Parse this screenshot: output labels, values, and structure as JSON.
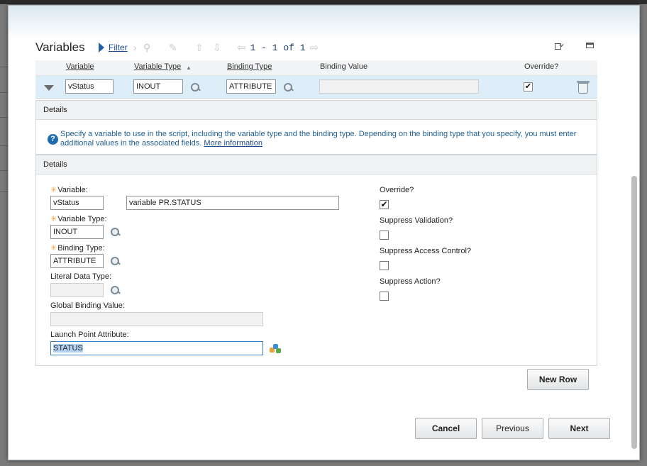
{
  "section": {
    "title": "Variables",
    "filter_label": "Filter",
    "pager_text": "1 - 1 of 1"
  },
  "table": {
    "columns": [
      "Variable",
      "Variable Type",
      "Binding Type",
      "Binding Value",
      "Override?"
    ],
    "rows": [
      {
        "variable": "vStatus",
        "variable_type": "INOUT",
        "binding_type": "ATTRIBUTE",
        "binding_value": "",
        "override": true
      }
    ]
  },
  "details_top": {
    "header": "Details",
    "help_text": "Specify a variable to use in the script, including the variable type and the binding type. Depending on the binding type that you specify, you must enter additional values in the associated fields.",
    "help_link": "More information"
  },
  "details_form": {
    "header": "Details",
    "variable_label": "Variable:",
    "variable_value": "vStatus",
    "variable_description": "variable PR.STATUS",
    "variable_type_label": "Variable Type:",
    "variable_type_value": "INOUT",
    "binding_type_label": "Binding Type:",
    "binding_type_value": "ATTRIBUTE",
    "literal_data_type_label": "Literal Data Type:",
    "literal_data_type_value": "",
    "global_binding_value_label": "Global Binding Value:",
    "global_binding_value": "",
    "launch_point_attribute_label": "Launch Point Attribute:",
    "launch_point_attribute_value": "STATUS",
    "override_label": "Override?",
    "override_checked": true,
    "suppress_validation_label": "Suppress Validation?",
    "suppress_validation_checked": false,
    "suppress_access_control_label": "Suppress Access Control?",
    "suppress_access_control_checked": false,
    "suppress_action_label": "Suppress Action?",
    "suppress_action_checked": false
  },
  "buttons": {
    "new_row": "New Row",
    "cancel": "Cancel",
    "previous": "Previous",
    "next": "Next"
  },
  "colors": {
    "accent": "#1e5fa8",
    "row_highlight": "#deeef8",
    "required_marker": "#e8a23a"
  }
}
